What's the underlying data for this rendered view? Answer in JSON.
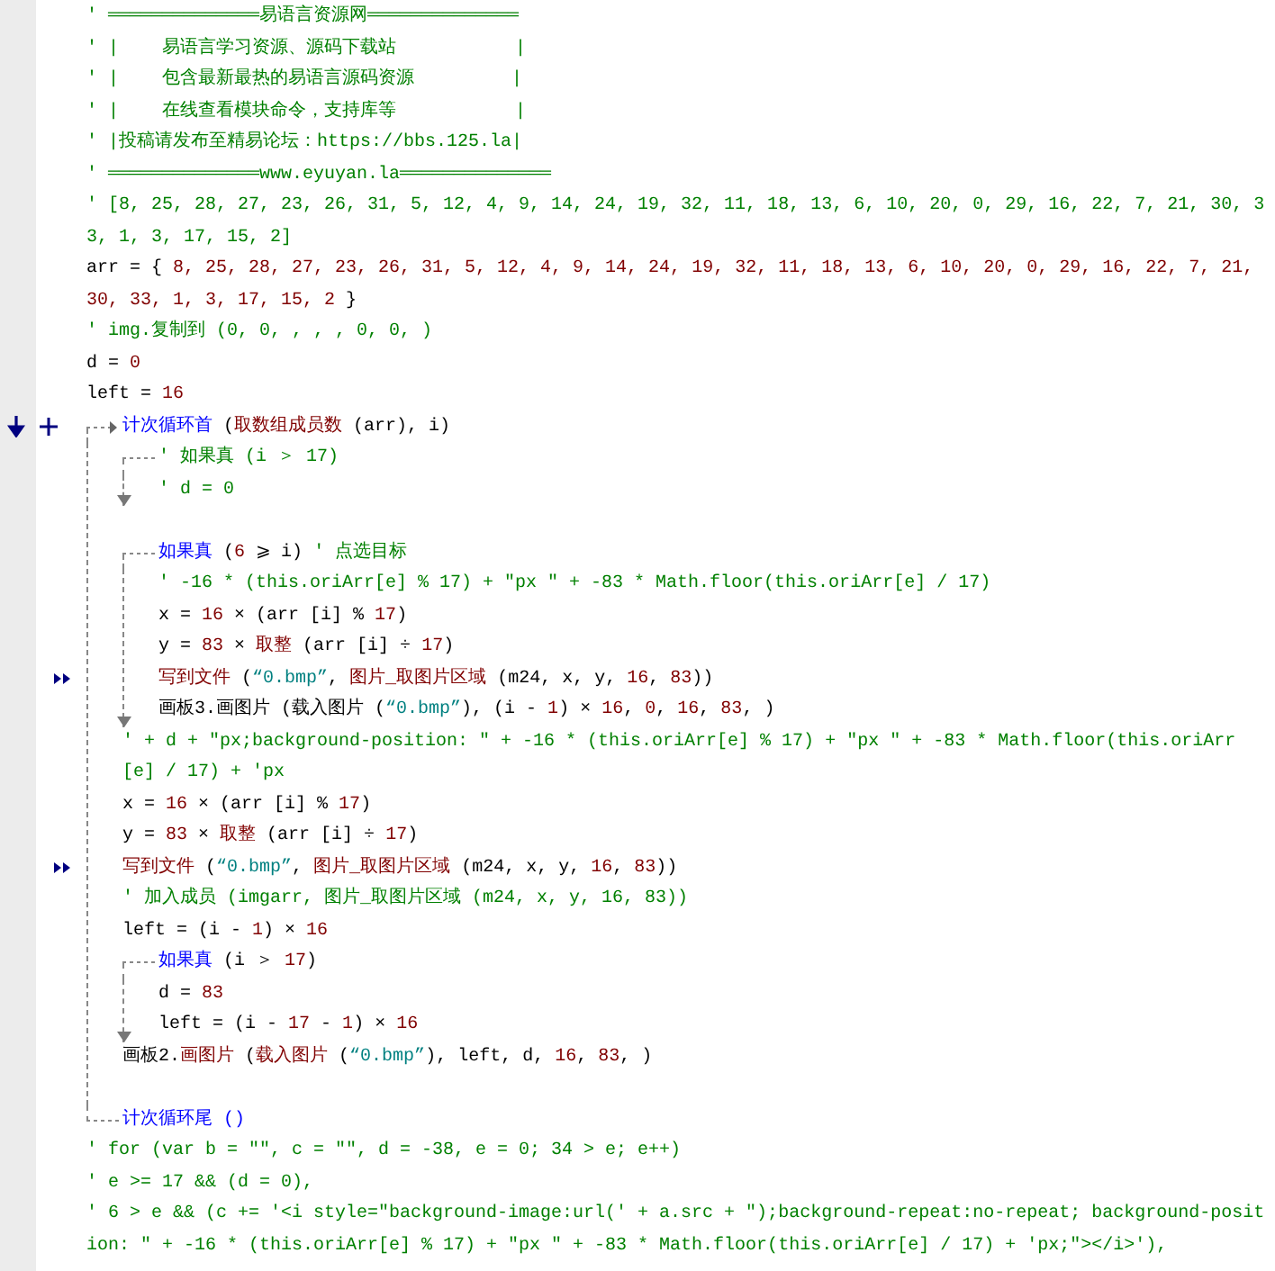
{
  "code": [
    {
      "kind": "line",
      "tokens": [
        {
          "kind": "comment",
          "text": "' ══════════════易语言资源网══════════════"
        }
      ]
    },
    {
      "kind": "line",
      "tokens": [
        {
          "kind": "comment",
          "text": "' |    易语言学习资源、源码下载站           |"
        }
      ]
    },
    {
      "kind": "line",
      "tokens": [
        {
          "kind": "comment",
          "text": "' |    包含最新最热的易语言源码资源         |"
        }
      ]
    },
    {
      "kind": "line",
      "tokens": [
        {
          "kind": "comment",
          "text": "' |    在线查看模块命令，支持库等           |"
        }
      ]
    },
    {
      "kind": "line",
      "tokens": [
        {
          "kind": "comment",
          "text": "' |投稿请发布至精易论坛：https://bbs.125.la|"
        }
      ]
    },
    {
      "kind": "line",
      "tokens": [
        {
          "kind": "comment",
          "text": "' ══════════════www.eyuyan.la══════════════"
        }
      ]
    },
    {
      "kind": "line",
      "tokens": [
        {
          "kind": "comment",
          "text": "' [8, 25, 28, 27, 23, 26, 31, 5, 12, 4, 9, 14, 24, 19, 32, 11, 18, 13, 6, 10, 20, 0, 29, 16, 22, 7, 21, 30, 33, 1, 3, 17, 15, 2]"
        }
      ]
    },
    {
      "kind": "line",
      "tokens": [
        {
          "kind": "plain",
          "text": "arr = { "
        },
        {
          "kind": "number",
          "text": "8, 25, 28, 27, 23, 26, 31, 5, 12, 4, 9, 14, 24, 19, 32, 11, 18, 13, 6, 10, 20, 0, 29, 16, 22, 7, 21, 30, 33, 1, 3, 17, 15, 2"
        },
        {
          "kind": "plain",
          "text": " }"
        }
      ]
    },
    {
      "kind": "line",
      "tokens": [
        {
          "kind": "comment",
          "text": "' img.复制到 (0, 0, , , , 0, 0, )"
        }
      ]
    },
    {
      "kind": "line",
      "tokens": [
        {
          "kind": "plain",
          "text": "d = "
        },
        {
          "kind": "number",
          "text": "0"
        }
      ]
    },
    {
      "kind": "line",
      "tokens": [
        {
          "kind": "plain",
          "text": "left = "
        },
        {
          "kind": "number",
          "text": "16"
        }
      ]
    },
    {
      "kind": "loop",
      "gutter_icons": [
        {
          "kind": "down-arrow"
        },
        {
          "kind": "plus"
        }
      ],
      "header": [
        {
          "kind": "keyword",
          "text": "计次循环首 "
        },
        {
          "kind": "plain",
          "text": "("
        },
        {
          "kind": "function",
          "text": "取数组成员数"
        },
        {
          "kind": "plain",
          "text": " (arr), i)"
        }
      ],
      "children": [
        {
          "kind": "if",
          "header": [
            {
              "kind": "comment",
              "text": "' 如果真 (i ＞ 17)"
            }
          ],
          "children": [
            {
              "kind": "line",
              "tokens": [
                {
                  "kind": "comment",
                  "text": "' d = 0"
                }
              ]
            }
          ]
        },
        {
          "kind": "blank"
        },
        {
          "kind": "if",
          "header": [
            {
              "kind": "keyword",
              "text": "如果真 "
            },
            {
              "kind": "plain",
              "text": "("
            },
            {
              "kind": "number",
              "text": "6"
            },
            {
              "kind": "plain",
              "text": " ⩾ i) "
            },
            {
              "kind": "comment",
              "text": "' 点选目标"
            }
          ],
          "children": [
            {
              "kind": "line",
              "tokens": [
                {
                  "kind": "comment",
                  "text": "' -16 * (this.oriArr[e] % 17) + \"px \" + -83 * Math.floor(this.oriArr[e] / 17)"
                }
              ]
            },
            {
              "kind": "line",
              "tokens": [
                {
                  "kind": "plain",
                  "text": "x = "
                },
                {
                  "kind": "number",
                  "text": "16"
                },
                {
                  "kind": "plain",
                  "text": " × (arr [i] % "
                },
                {
                  "kind": "number",
                  "text": "17"
                },
                {
                  "kind": "plain",
                  "text": ")"
                }
              ]
            },
            {
              "kind": "line",
              "tokens": [
                {
                  "kind": "plain",
                  "text": "y = "
                },
                {
                  "kind": "number",
                  "text": "83"
                },
                {
                  "kind": "plain",
                  "text": " × "
                },
                {
                  "kind": "function",
                  "text": "取整"
                },
                {
                  "kind": "plain",
                  "text": " (arr [i] ÷ "
                },
                {
                  "kind": "number",
                  "text": "17"
                },
                {
                  "kind": "plain",
                  "text": ")"
                }
              ]
            },
            {
              "kind": "line",
              "gutter_icons": [
                {
                  "kind": "double-arrow"
                }
              ],
              "tokens": [
                {
                  "kind": "function",
                  "text": "写到文件"
                },
                {
                  "kind": "plain",
                  "text": " ("
                },
                {
                  "kind": "string",
                  "text": "“0.bmp”"
                },
                {
                  "kind": "plain",
                  "text": ", "
                },
                {
                  "kind": "function",
                  "text": "图片_取图片区域"
                },
                {
                  "kind": "plain",
                  "text": " (m24, x, y, "
                },
                {
                  "kind": "number",
                  "text": "16"
                },
                {
                  "kind": "plain",
                  "text": ", "
                },
                {
                  "kind": "number",
                  "text": "83"
                },
                {
                  "kind": "plain",
                  "text": "))"
                }
              ]
            },
            {
              "kind": "line",
              "tokens": [
                {
                  "kind": "plain",
                  "text": "画板3.画图片 (载入图片 ("
                },
                {
                  "kind": "string",
                  "text": "“0.bmp”"
                },
                {
                  "kind": "plain",
                  "text": "), (i - "
                },
                {
                  "kind": "number",
                  "text": "1"
                },
                {
                  "kind": "plain",
                  "text": ") × "
                },
                {
                  "kind": "number",
                  "text": "16"
                },
                {
                  "kind": "plain",
                  "text": ", "
                },
                {
                  "kind": "number",
                  "text": "0"
                },
                {
                  "kind": "plain",
                  "text": ", "
                },
                {
                  "kind": "number",
                  "text": "16"
                },
                {
                  "kind": "plain",
                  "text": ", "
                },
                {
                  "kind": "number",
                  "text": "83"
                },
                {
                  "kind": "plain",
                  "text": ", )"
                }
              ]
            }
          ]
        },
        {
          "kind": "line",
          "tokens": [
            {
              "kind": "comment",
              "text": "' + d + \"px;background-position: \" + -16 * (this.oriArr[e] % 17) + \"px \" + -83 * Math.floor(this.oriArr[e] / 17) + 'px"
            }
          ]
        },
        {
          "kind": "line",
          "tokens": [
            {
              "kind": "plain",
              "text": "x = "
            },
            {
              "kind": "number",
              "text": "16"
            },
            {
              "kind": "plain",
              "text": " × (arr [i] % "
            },
            {
              "kind": "number",
              "text": "17"
            },
            {
              "kind": "plain",
              "text": ")"
            }
          ]
        },
        {
          "kind": "line",
          "tokens": [
            {
              "kind": "plain",
              "text": "y = "
            },
            {
              "kind": "number",
              "text": "83"
            },
            {
              "kind": "plain",
              "text": " × "
            },
            {
              "kind": "function",
              "text": "取整"
            },
            {
              "kind": "plain",
              "text": " (arr [i] ÷ "
            },
            {
              "kind": "number",
              "text": "17"
            },
            {
              "kind": "plain",
              "text": ")"
            }
          ]
        },
        {
          "kind": "line",
          "gutter_icons": [
            {
              "kind": "double-arrow"
            }
          ],
          "tokens": [
            {
              "kind": "function",
              "text": "写到文件"
            },
            {
              "kind": "plain",
              "text": " ("
            },
            {
              "kind": "string",
              "text": "“0.bmp”"
            },
            {
              "kind": "plain",
              "text": ", "
            },
            {
              "kind": "function",
              "text": "图片_取图片区域"
            },
            {
              "kind": "plain",
              "text": " (m24, x, y, "
            },
            {
              "kind": "number",
              "text": "16"
            },
            {
              "kind": "plain",
              "text": ", "
            },
            {
              "kind": "number",
              "text": "83"
            },
            {
              "kind": "plain",
              "text": "))"
            }
          ]
        },
        {
          "kind": "line",
          "tokens": [
            {
              "kind": "comment",
              "text": "' 加入成员 (imgarr, 图片_取图片区域 (m24, x, y, 16, 83))"
            }
          ]
        },
        {
          "kind": "line",
          "tokens": [
            {
              "kind": "plain",
              "text": "left = (i - "
            },
            {
              "kind": "number",
              "text": "1"
            },
            {
              "kind": "plain",
              "text": ") × "
            },
            {
              "kind": "number",
              "text": "16"
            }
          ]
        },
        {
          "kind": "if",
          "header": [
            {
              "kind": "keyword",
              "text": "如果真 "
            },
            {
              "kind": "plain",
              "text": "(i ＞ "
            },
            {
              "kind": "number",
              "text": "17"
            },
            {
              "kind": "plain",
              "text": ")"
            }
          ],
          "children": [
            {
              "kind": "line",
              "tokens": [
                {
                  "kind": "plain",
                  "text": "d = "
                },
                {
                  "kind": "number",
                  "text": "83"
                }
              ]
            },
            {
              "kind": "line",
              "tokens": [
                {
                  "kind": "plain",
                  "text": "left = (i - "
                },
                {
                  "kind": "number",
                  "text": "17"
                },
                {
                  "kind": "plain",
                  "text": " - "
                },
                {
                  "kind": "number",
                  "text": "1"
                },
                {
                  "kind": "plain",
                  "text": ") × "
                },
                {
                  "kind": "number",
                  "text": "16"
                }
              ]
            }
          ]
        },
        {
          "kind": "line",
          "tokens": [
            {
              "kind": "plain",
              "text": "画板2."
            },
            {
              "kind": "function",
              "text": "画图片"
            },
            {
              "kind": "plain",
              "text": " ("
            },
            {
              "kind": "function",
              "text": "载入图片"
            },
            {
              "kind": "plain",
              "text": " ("
            },
            {
              "kind": "string",
              "text": "“0.bmp”"
            },
            {
              "kind": "plain",
              "text": "), left, d, "
            },
            {
              "kind": "number",
              "text": "16"
            },
            {
              "kind": "plain",
              "text": ", "
            },
            {
              "kind": "number",
              "text": "83"
            },
            {
              "kind": "plain",
              "text": ", )"
            }
          ]
        },
        {
          "kind": "blank"
        }
      ],
      "footer": [
        {
          "kind": "keyword",
          "text": "计次循环尾 ()"
        }
      ]
    },
    {
      "kind": "line",
      "tokens": [
        {
          "kind": "comment",
          "text": "' for (var b = \"\", c = \"\", d = -38, e = 0; 34 > e; e++)"
        }
      ]
    },
    {
      "kind": "line",
      "tokens": [
        {
          "kind": "comment",
          "text": "' e >= 17 && (d = 0),"
        }
      ]
    },
    {
      "kind": "line",
      "tokens": [
        {
          "kind": "comment",
          "text": "' 6 > e && (c += '<i style=\"background-image:url(' + a.src + \");background-repeat:no-repeat; background-position: \" + -16 * (this.oriArr[e] % 17) + \"px \" + -83 * Math.floor(this.oriArr[e] / 17) + 'px;\"></i>'),"
        }
      ]
    }
  ]
}
